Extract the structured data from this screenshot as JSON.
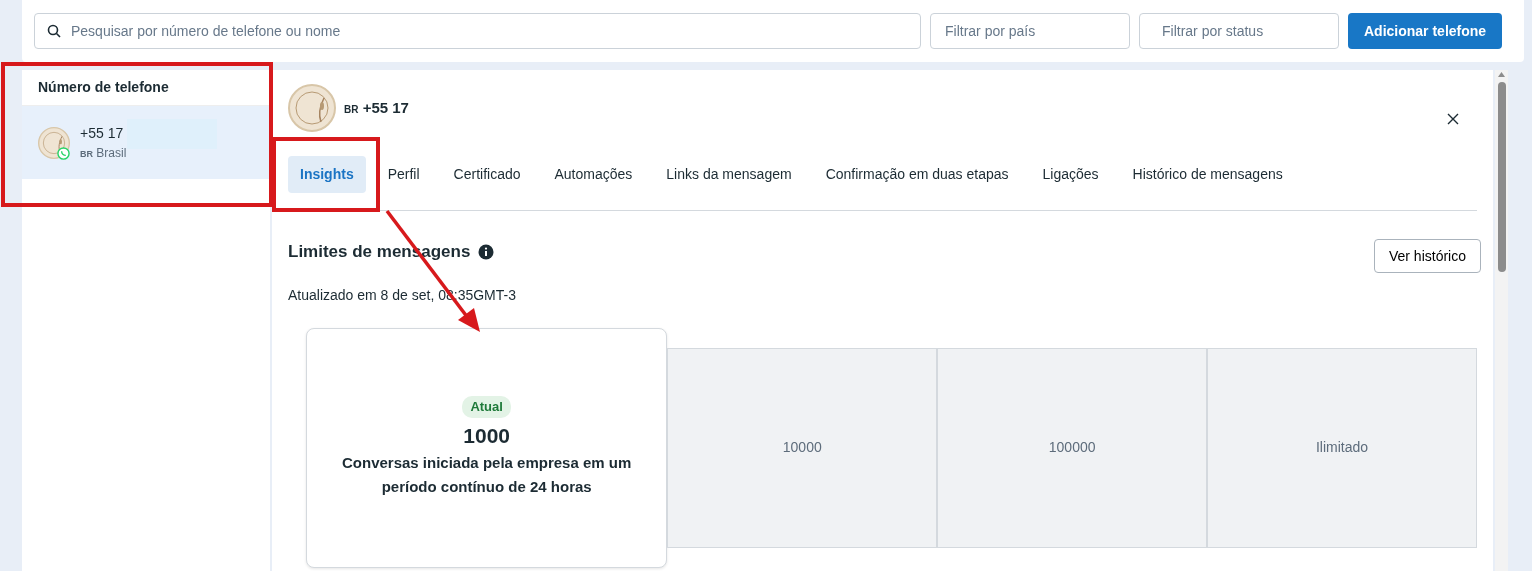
{
  "toolbar": {
    "search": {
      "placeholder": "Pesquisar por número de telefone ou nome"
    },
    "filters": [
      {
        "placeholder": "Filtrar por país",
        "kind": "plain"
      },
      {
        "placeholder": "Filtrar por status",
        "kind": "funnel"
      }
    ],
    "add_button": "Adicionar telefone"
  },
  "phone_list": {
    "header": "Número de telefone",
    "items": [
      {
        "number": "+55 17",
        "country_code": "BR",
        "country": "Brasil",
        "selected": true
      }
    ]
  },
  "detail": {
    "country_code": "BR",
    "number": "+55 17",
    "tabs": [
      {
        "label": "Insights",
        "selected": true
      },
      {
        "label": "Perfil",
        "selected": false
      },
      {
        "label": "Certificado",
        "selected": false
      },
      {
        "label": "Automações",
        "selected": false
      },
      {
        "label": "Links da mensagem",
        "selected": false
      },
      {
        "label": "Confirmação em duas etapas",
        "selected": false
      },
      {
        "label": "Ligações",
        "selected": false
      },
      {
        "label": "Histórico de mensagens",
        "selected": false
      }
    ],
    "section_title": "Limites de mensagens",
    "updated": "Atualizado em 8 de set, 08:35GMT-3",
    "history_button": "Ver histórico",
    "tiers": [
      {
        "value": "1000",
        "selected": true,
        "badge": "Atual",
        "description": "Conversas iniciada pela empresa em um período contínuo de 24 horas"
      },
      {
        "value": "10000",
        "selected": false
      },
      {
        "value": "100000",
        "selected": false
      },
      {
        "value": "Ilimitado",
        "selected": false
      }
    ]
  },
  "annotations": [
    {
      "kind": "rect"
    },
    {
      "kind": "rect"
    },
    {
      "kind": "arrow"
    }
  ]
}
